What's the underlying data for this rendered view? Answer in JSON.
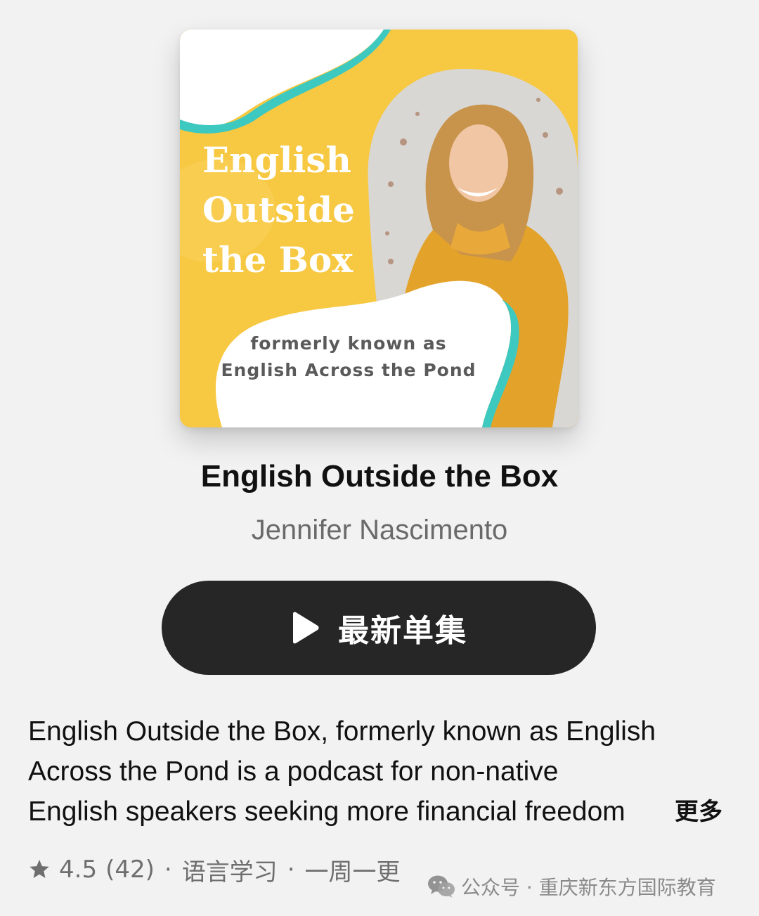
{
  "artwork": {
    "title_lines": [
      "English",
      "Outside",
      "the Box"
    ],
    "subtitle_lines": [
      "formerly known as",
      "English Across the Pond"
    ],
    "colors": {
      "background": "#f7c842",
      "accent": "#3ec9c0",
      "blob": "#ffffff"
    }
  },
  "podcast": {
    "title": "English Outside the Box",
    "author": "Jennifer Nascimento"
  },
  "play_button": {
    "label": "最新单集",
    "icon": "play-icon"
  },
  "description": {
    "lines": [
      "English Outside the Box, formerly known as English",
      "Across the Pond is a podcast for non-native",
      "English speakers seeking more financial freedom"
    ],
    "more_label": "更多"
  },
  "meta": {
    "star_icon": "star-icon",
    "rating": "4.5",
    "rating_count": "(42)",
    "separator": "·",
    "category": "语言学习",
    "frequency": "一周一更"
  },
  "watermark": {
    "icon": "wechat-icon",
    "text": "公众号 · 重庆新东方国际教育"
  }
}
